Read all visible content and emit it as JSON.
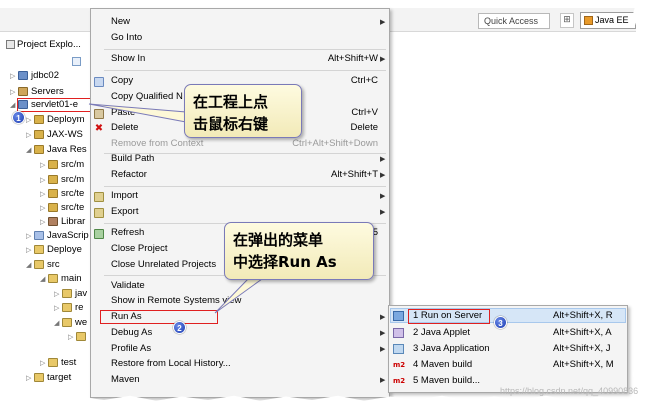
{
  "toolbar": {
    "quick_access": "Quick Access",
    "perspective": "Java EE"
  },
  "explorer": {
    "title": "Project Explo...",
    "items": [
      {
        "label": "jdbc02",
        "icon": "project-icon"
      },
      {
        "label": "Servers",
        "icon": "server-folder-icon"
      },
      {
        "label": "servlet01-e",
        "icon": "project-icon"
      },
      {
        "label": "Deploym",
        "icon": "deployment-icon"
      },
      {
        "label": "JAX-WS",
        "icon": "jaxws-icon"
      },
      {
        "label": "Java Res",
        "icon": "java-resources-icon"
      },
      {
        "label": "src/m",
        "icon": "package-folder-icon"
      },
      {
        "label": "src/m",
        "icon": "package-folder-icon"
      },
      {
        "label": "src/te",
        "icon": "package-folder-icon"
      },
      {
        "label": "src/te",
        "icon": "package-folder-icon"
      },
      {
        "label": "Librar",
        "icon": "library-icon"
      },
      {
        "label": "JavaScrip",
        "icon": "javascript-icon"
      },
      {
        "label": "Deploye",
        "icon": "deployed-icon"
      },
      {
        "label": "src",
        "icon": "folder-icon"
      },
      {
        "label": "main",
        "icon": "folder-icon"
      },
      {
        "label": "jav",
        "icon": "folder-icon"
      },
      {
        "label": "re",
        "icon": "folder-icon"
      },
      {
        "label": "we",
        "icon": "folder-icon"
      },
      {
        "label": "",
        "icon": "folder-icon"
      },
      {
        "label": "test",
        "icon": "folder-icon"
      },
      {
        "label": "target",
        "icon": "folder-icon"
      }
    ]
  },
  "menu": {
    "items": [
      {
        "label": "New",
        "shortcut": "",
        "submenu": true,
        "disabled": false
      },
      {
        "label": "Go Into",
        "shortcut": "",
        "submenu": false,
        "disabled": false
      },
      {
        "label": "Show In",
        "shortcut": "Alt+Shift+W",
        "submenu": true,
        "disabled": false
      },
      {
        "label": "Copy",
        "shortcut": "Ctrl+C",
        "submenu": false,
        "disabled": false
      },
      {
        "label": "Copy Qualified N",
        "shortcut": "",
        "submenu": false,
        "disabled": false
      },
      {
        "label": "Paste",
        "shortcut": "Ctrl+V",
        "submenu": false,
        "disabled": false
      },
      {
        "label": "Delete",
        "shortcut": "Delete",
        "submenu": false,
        "disabled": false
      },
      {
        "label": "Remove from Context",
        "shortcut": "Ctrl+Alt+Shift+Down",
        "submenu": false,
        "disabled": true
      },
      {
        "label": "Build Path",
        "shortcut": "",
        "submenu": true,
        "disabled": false
      },
      {
        "label": "Refactor",
        "shortcut": "Alt+Shift+T",
        "submenu": true,
        "disabled": false
      },
      {
        "label": "Import",
        "shortcut": "",
        "submenu": true,
        "disabled": false
      },
      {
        "label": "Export",
        "shortcut": "",
        "submenu": true,
        "disabled": false
      },
      {
        "label": "Refresh",
        "shortcut": "5",
        "submenu": false,
        "disabled": false
      },
      {
        "label": "Close Project",
        "shortcut": "",
        "submenu": false,
        "disabled": false
      },
      {
        "label": "Close Unrelated Projects",
        "shortcut": "",
        "submenu": false,
        "disabled": false
      },
      {
        "label": "Validate",
        "shortcut": "",
        "submenu": false,
        "disabled": false
      },
      {
        "label": "Show in Remote Systems view",
        "shortcut": "",
        "submenu": false,
        "disabled": false
      },
      {
        "label": "Run As",
        "shortcut": "",
        "submenu": true,
        "disabled": false
      },
      {
        "label": "Debug As",
        "shortcut": "",
        "submenu": true,
        "disabled": false
      },
      {
        "label": "Profile As",
        "shortcut": "",
        "submenu": true,
        "disabled": false
      },
      {
        "label": "Restore from Local History...",
        "shortcut": "",
        "submenu": false,
        "disabled": false
      },
      {
        "label": "Maven",
        "shortcut": "",
        "submenu": true,
        "disabled": false
      }
    ]
  },
  "submenu": {
    "items": [
      {
        "label": "1 Run on Server",
        "shortcut": "Alt+Shift+X, R",
        "icon": "server-run-icon"
      },
      {
        "label": "2 Java Applet",
        "shortcut": "Alt+Shift+X, A",
        "icon": "java-applet-icon"
      },
      {
        "label": "3 Java Application",
        "shortcut": "Alt+Shift+X, J",
        "icon": "java-app-icon"
      },
      {
        "label": "4 Maven build",
        "shortcut": "Alt+Shift+X, M",
        "icon": "maven-icon"
      },
      {
        "label": "5 Maven build...",
        "shortcut": "",
        "icon": "maven-icon"
      }
    ]
  },
  "callouts": {
    "first": [
      "在工程上点",
      "击鼠标右键"
    ],
    "second": [
      "在弹出的菜单",
      "中选择Run As"
    ]
  },
  "badges": [
    "1",
    "2",
    "3"
  ],
  "icons": {
    "m2": "m2"
  },
  "watermark": "https://blog.csdn.net/qq_40990836"
}
